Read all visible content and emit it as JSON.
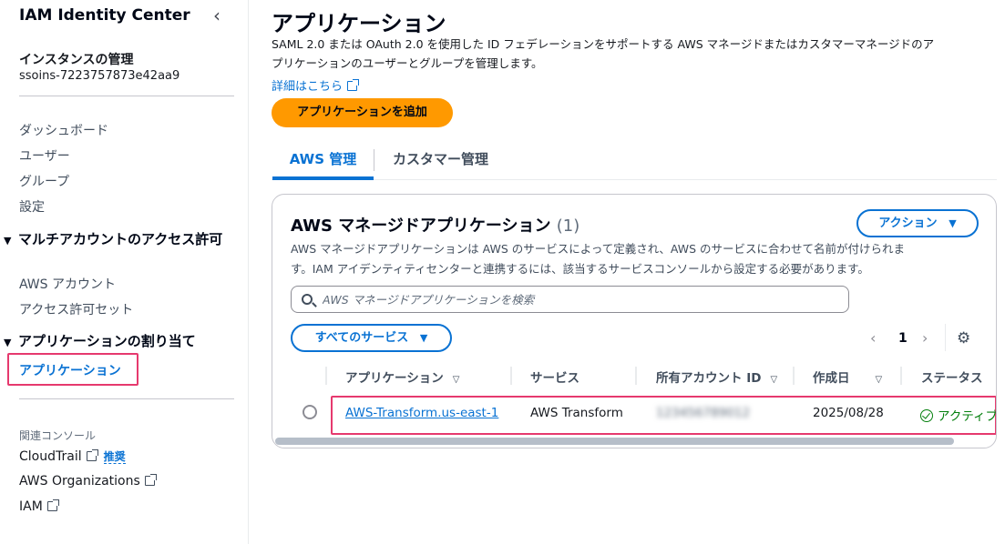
{
  "sidebar": {
    "title": "IAM Identity Center",
    "collapse_icon": "‹",
    "instance_title": "インスタンスの管理",
    "instance_id": "ssoins-7223757873e42aa9",
    "links": [
      "ダッシュボード",
      "ユーザー",
      "グループ",
      "設定"
    ],
    "section_multi": "マルチアカウントのアクセス許可",
    "multi_links": [
      "AWS アカウント",
      "アクセス許可セット"
    ],
    "section_app": "アプリケーションの割り当て",
    "app_active": "アプリケーション",
    "related_title": "関連コンソール",
    "related": {
      "cloudtrail": "CloudTrail",
      "recommended": "推奨",
      "organizations": "AWS Organizations",
      "iam": "IAM"
    }
  },
  "main": {
    "title": "アプリケーション",
    "description_line1": "SAML 2.0 または OAuth 2.0 を使用した ID フェデレーションをサポートする AWS マネージドまたはカスタマーマネージドのア",
    "description_line2": "プリケーションのユーザーとグループを管理します。",
    "learn_more": "詳細はこちら",
    "add_button": "アプリケーションを追加",
    "tabs": [
      "AWS 管理",
      "カスタマー管理"
    ]
  },
  "panel": {
    "title": "AWS マネージドアプリケーション",
    "count": "(1)",
    "actions_button": "アクション",
    "desc_line1": "AWS マネージドアプリケーションは AWS のサービスによって定義され、AWS のサービスに合わせて名前が付けられま",
    "desc_line2": "す。IAM アイデンティティセンターと連携するには、該当するサービスコンソールから設定する必要があります。",
    "search_placeholder": "AWS マネージドアプリケーションを検索",
    "services_filter": "すべてのサービス",
    "page_number": "1",
    "columns": [
      "アプリケーション",
      "サービス",
      "所有アカウント ID",
      "作成日",
      "ステータス"
    ],
    "rows": [
      {
        "application": "AWS-Transform.us-east-1",
        "service": "AWS Transform",
        "account_id": "123456789012",
        "created": "2025/08/28",
        "status": "アクティブ"
      }
    ]
  },
  "colors": {
    "primary": "#0972d3",
    "accent": "#ff9900",
    "highlight": "#e6396e",
    "success": "#037f0c"
  }
}
